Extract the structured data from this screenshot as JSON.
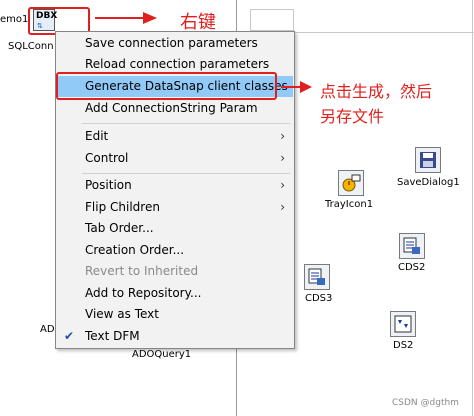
{
  "form": {
    "memo_label": "emo1",
    "sqlconn_label": "SQLConn",
    "ado_label": "ADO",
    "adoquery_label": "ADOQuery1",
    "dbx_text": "DBX"
  },
  "components": [
    {
      "label": "SaveDialog1",
      "icon": "save-dialog-icon"
    },
    {
      "label": "TrayIcon1",
      "icon": "tray-icon-icon"
    },
    {
      "label": "CDS2",
      "icon": "client-dataset-icon"
    },
    {
      "label": "CDS3",
      "icon": "client-dataset-icon"
    },
    {
      "label": "DS2",
      "icon": "datasource-icon"
    }
  ],
  "menu": {
    "items": [
      {
        "label": "Save connection parameters",
        "submenu": false,
        "disabled": false
      },
      {
        "label": "Reload connection parameters",
        "submenu": false,
        "disabled": false
      },
      {
        "label": "Generate DataSnap client classes",
        "submenu": false,
        "disabled": false,
        "highlighted": true
      },
      {
        "label": "Add ConnectionString Param",
        "submenu": false,
        "disabled": false
      },
      {
        "label": "Edit",
        "submenu": true,
        "disabled": false
      },
      {
        "label": "Control",
        "submenu": true,
        "disabled": false
      },
      {
        "label": "Position",
        "submenu": true,
        "disabled": false
      },
      {
        "label": "Flip Children",
        "submenu": true,
        "disabled": false
      },
      {
        "label": "Tab Order...",
        "submenu": false,
        "disabled": false
      },
      {
        "label": "Creation Order...",
        "submenu": false,
        "disabled": false
      },
      {
        "label": "Revert to Inherited",
        "submenu": false,
        "disabled": true
      },
      {
        "label": "Add to Repository...",
        "submenu": false,
        "disabled": false
      },
      {
        "label": "View as Text",
        "submenu": false,
        "disabled": false
      },
      {
        "label": "Text DFM",
        "submenu": false,
        "disabled": false,
        "checked": true
      }
    ],
    "chevron": "›",
    "check_mark": "✔"
  },
  "annotations": {
    "right_click": "右键",
    "generate_line1": "点击生成，然后",
    "generate_line2": "另存文件"
  },
  "colors": {
    "annotation_red": "#e0201e",
    "highlight_blue": "#91c9f7",
    "menu_background": "#f2f2f2"
  },
  "watermark": "CSDN @dgthm"
}
